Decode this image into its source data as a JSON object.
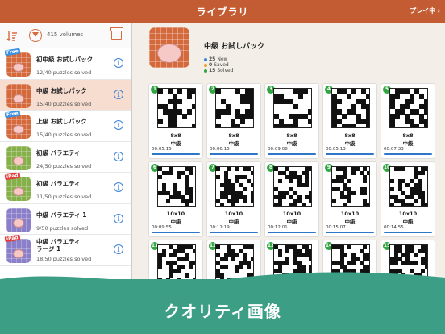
{
  "header": {
    "title": "ライブラリ",
    "play_label": "プレイ中"
  },
  "library": {
    "volume_count": "415 volumes",
    "items": [
      {
        "tag": "Free",
        "tag_type": "free",
        "name": "初中級 お試しパック",
        "solved": "12/40 puzzles solved",
        "color": "#d46a3c",
        "selected": false
      },
      {
        "tag": "",
        "tag_type": "",
        "name": "中級 お試しパック",
        "solved": "15/40 puzzles solved",
        "color": "#d46a3c",
        "selected": true
      },
      {
        "tag": "Free",
        "tag_type": "free",
        "name": "上級 お試しパック",
        "solved": "15/40 puzzles solved",
        "color": "#d46a3c",
        "selected": false
      },
      {
        "tag": "",
        "tag_type": "",
        "name": "初級 バラエティ",
        "solved": "24/50 puzzles solved",
        "color": "#86b04a",
        "selected": false
      },
      {
        "tag": "iPad",
        "tag_type": "ipad",
        "name": "初級 バラエティ",
        "solved": "11/50 puzzles solved",
        "color": "#86b04a",
        "selected": false
      },
      {
        "tag": "",
        "tag_type": "",
        "name": "中級 バラエティ 1",
        "solved": "9/50 puzzles solved",
        "color": "#8a7fc8",
        "selected": false
      },
      {
        "tag": "iPad",
        "tag_type": "ipad",
        "name": "中級 バラエティ\nラージ 1",
        "solved": "18/50 puzzles solved",
        "color": "#8a7fc8",
        "selected": false
      }
    ]
  },
  "pack": {
    "title": "中級 お試しパック",
    "stats": [
      {
        "count": "25",
        "label": "New",
        "color": "#3b82d4"
      },
      {
        "count": "0",
        "label": "Saved",
        "color": "#e8a020"
      },
      {
        "count": "15",
        "label": "Solved",
        "color": "#2fa640"
      }
    ]
  },
  "puzzles": [
    {
      "num": "1",
      "size": "8x8",
      "level": "中級",
      "time": "00:05:15"
    },
    {
      "num": "2",
      "size": "8x8",
      "level": "中級",
      "time": "00:06:15"
    },
    {
      "num": "3",
      "size": "8x8",
      "level": "中級",
      "time": "00:09:08"
    },
    {
      "num": "4",
      "size": "8x8",
      "level": "中級",
      "time": "00:05:13"
    },
    {
      "num": "5",
      "size": "8x8",
      "level": "中級",
      "time": "00:07:33"
    },
    {
      "num": "6",
      "size": "10x10",
      "level": "中級",
      "time": "00:09:55"
    },
    {
      "num": "7",
      "size": "10x10",
      "level": "中級",
      "time": "00:11:19"
    },
    {
      "num": "8",
      "size": "10x10",
      "level": "中級",
      "time": "00:12:01"
    },
    {
      "num": "9",
      "size": "10x10",
      "level": "中級",
      "time": "00:15:07"
    },
    {
      "num": "10",
      "size": "10x10",
      "level": "中級",
      "time": "00:14:55"
    },
    {
      "num": "11",
      "size": "",
      "level": "",
      "time": ""
    },
    {
      "num": "12",
      "size": "",
      "level": "",
      "time": ""
    },
    {
      "num": "13",
      "size": "",
      "level": "",
      "time": ""
    },
    {
      "num": "14",
      "size": "",
      "level": "",
      "time": ""
    },
    {
      "num": "15",
      "size": "",
      "level": "",
      "time": ""
    }
  ],
  "banner": {
    "text": "クオリティ画像"
  }
}
